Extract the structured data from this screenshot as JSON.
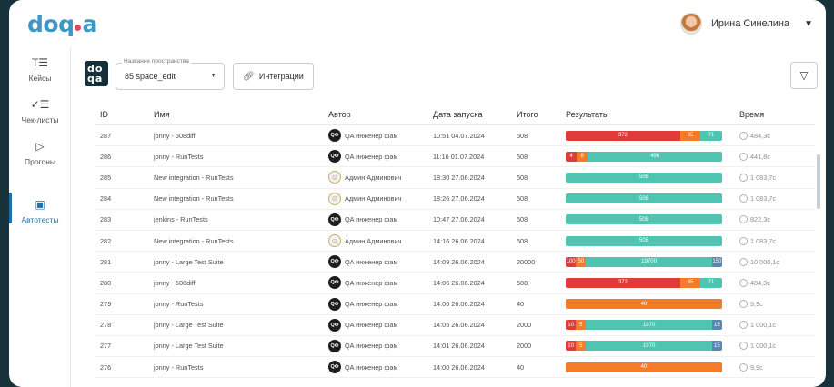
{
  "app": {
    "logo_text": "doqa",
    "user_name": "Ирина Синелина"
  },
  "sidebar": {
    "items": [
      {
        "label": "Кейсы",
        "icon": "cases-icon"
      },
      {
        "label": "Чек-листы",
        "icon": "checklist-icon"
      },
      {
        "label": "Прогоны",
        "icon": "play-icon"
      },
      {
        "label": "Автотесты",
        "icon": "autotest-icon",
        "active": true
      }
    ]
  },
  "toolbar": {
    "space_label": "Название пространства",
    "space_value": "85 space_edit",
    "integrations_label": "Интеграции"
  },
  "table": {
    "columns": [
      "ID",
      "Имя",
      "Автор",
      "Дата запуска",
      "Итого",
      "Результаты",
      "Время"
    ],
    "rows": [
      {
        "id": "287",
        "name": "jonny - 508diff",
        "author": "QA инженер фам",
        "author_type": "qa",
        "date": "10:51 04.07.2024",
        "total": "508",
        "results": [
          {
            "c": "red",
            "v": 372
          },
          {
            "c": "orange",
            "v": 65
          },
          {
            "c": "green",
            "v": 71
          }
        ],
        "time": "484,3с"
      },
      {
        "id": "286",
        "name": "jonny - RunTests",
        "author": "QA инженер фам",
        "author_type": "qa",
        "date": "11:16 01.07.2024",
        "total": "508",
        "results": [
          {
            "c": "red",
            "v": 4
          },
          {
            "c": "orange",
            "v": 8
          },
          {
            "c": "green",
            "v": 496
          }
        ],
        "time": "441,8с"
      },
      {
        "id": "285",
        "name": "New integration - RunTests",
        "author": "Админ Админович",
        "author_type": "admin",
        "date": "18:30 27.06.2024",
        "total": "508",
        "results": [
          {
            "c": "green",
            "v": 508
          }
        ],
        "time": "1 083,7с"
      },
      {
        "id": "284",
        "name": "New integration - RunTests",
        "author": "Админ Админович",
        "author_type": "admin",
        "date": "18:26 27.06.2024",
        "total": "508",
        "results": [
          {
            "c": "green",
            "v": 508
          }
        ],
        "time": "1 083,7с"
      },
      {
        "id": "283",
        "name": "jenkins - RunTests",
        "author": "QA инженер фам",
        "author_type": "qa",
        "date": "10:47 27.06.2024",
        "total": "508",
        "results": [
          {
            "c": "green",
            "v": 508
          }
        ],
        "time": "822,3с"
      },
      {
        "id": "282",
        "name": "New integration - RunTests",
        "author": "Админ Админович",
        "author_type": "admin",
        "date": "14:16 26.06.2024",
        "total": "508",
        "results": [
          {
            "c": "green",
            "v": 508
          }
        ],
        "time": "1 083,7с"
      },
      {
        "id": "281",
        "name": "jonny - Large Test Suite",
        "author": "QA инженер фам",
        "author_type": "qa",
        "date": "14:09 26.06.2024",
        "total": "20000",
        "results": [
          {
            "c": "red",
            "v": 100
          },
          {
            "c": "orange",
            "v": 50
          },
          {
            "c": "green",
            "v": 19700
          },
          {
            "c": "blue",
            "v": 150
          }
        ],
        "time": "10 000,1с"
      },
      {
        "id": "280",
        "name": "jonny - 508diff",
        "author": "QA инженер фам",
        "author_type": "qa",
        "date": "14:06 26.06.2024",
        "total": "508",
        "results": [
          {
            "c": "red",
            "v": 372
          },
          {
            "c": "orange",
            "v": 65
          },
          {
            "c": "green",
            "v": 71
          }
        ],
        "time": "484,3с"
      },
      {
        "id": "279",
        "name": "jonny - RunTests",
        "author": "QA инженер фам",
        "author_type": "qa",
        "date": "14:06 26.06.2024",
        "total": "40",
        "results": [
          {
            "c": "orange",
            "v": 40
          }
        ],
        "time": "9,9с"
      },
      {
        "id": "278",
        "name": "jonny - Large Test Suite",
        "author": "QA инженер фам",
        "author_type": "qa",
        "date": "14:05 26.06.2024",
        "total": "2000",
        "results": [
          {
            "c": "red",
            "v": 10
          },
          {
            "c": "orange",
            "v": 5
          },
          {
            "c": "green",
            "v": 1970
          },
          {
            "c": "blue",
            "v": 15
          }
        ],
        "time": "1 000,1с"
      },
      {
        "id": "277",
        "name": "jonny - Large Test Suite",
        "author": "QA инженер фам",
        "author_type": "qa",
        "date": "14:01 26.06.2024",
        "total": "2000",
        "results": [
          {
            "c": "red",
            "v": 10
          },
          {
            "c": "orange",
            "v": 5
          },
          {
            "c": "green",
            "v": 1970
          },
          {
            "c": "blue",
            "v": 15
          }
        ],
        "time": "1 000,1с"
      },
      {
        "id": "276",
        "name": "jonny - RunTests",
        "author": "QA инженер фам",
        "author_type": "qa",
        "date": "14:00 26.06.2024",
        "total": "40",
        "results": [
          {
            "c": "orange",
            "v": 40
          }
        ],
        "time": "9,9с"
      }
    ]
  },
  "colors": {
    "red": "#e03a3a",
    "orange": "#f47b2a",
    "green": "#4fc4b0",
    "blue": "#5a87b0",
    "accent": "#1f6fa8"
  }
}
